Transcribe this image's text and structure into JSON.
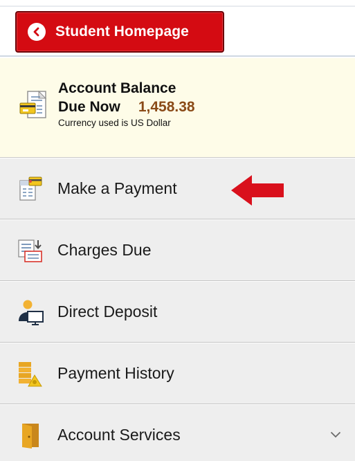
{
  "header": {
    "home_button_label": "Student Homepage"
  },
  "balance": {
    "title": "Account Balance",
    "due_label": "Due Now",
    "due_amount": "1,458.38",
    "currency_note": "Currency used is US Dollar"
  },
  "menu": {
    "items": [
      {
        "label": "Make a Payment",
        "icon": "make-payment-icon"
      },
      {
        "label": "Charges Due",
        "icon": "charges-due-icon"
      },
      {
        "label": "Direct Deposit",
        "icon": "direct-deposit-icon"
      },
      {
        "label": "Payment History",
        "icon": "payment-history-icon"
      },
      {
        "label": "Account Services",
        "icon": "account-services-icon",
        "expandable": true
      }
    ]
  },
  "colors": {
    "home_button": "#d40b12",
    "balance_bg": "#fefce8",
    "due_amount": "#8a4a17",
    "menu_bg": "#eeeeee",
    "annotation_arrow": "#d9101c"
  }
}
